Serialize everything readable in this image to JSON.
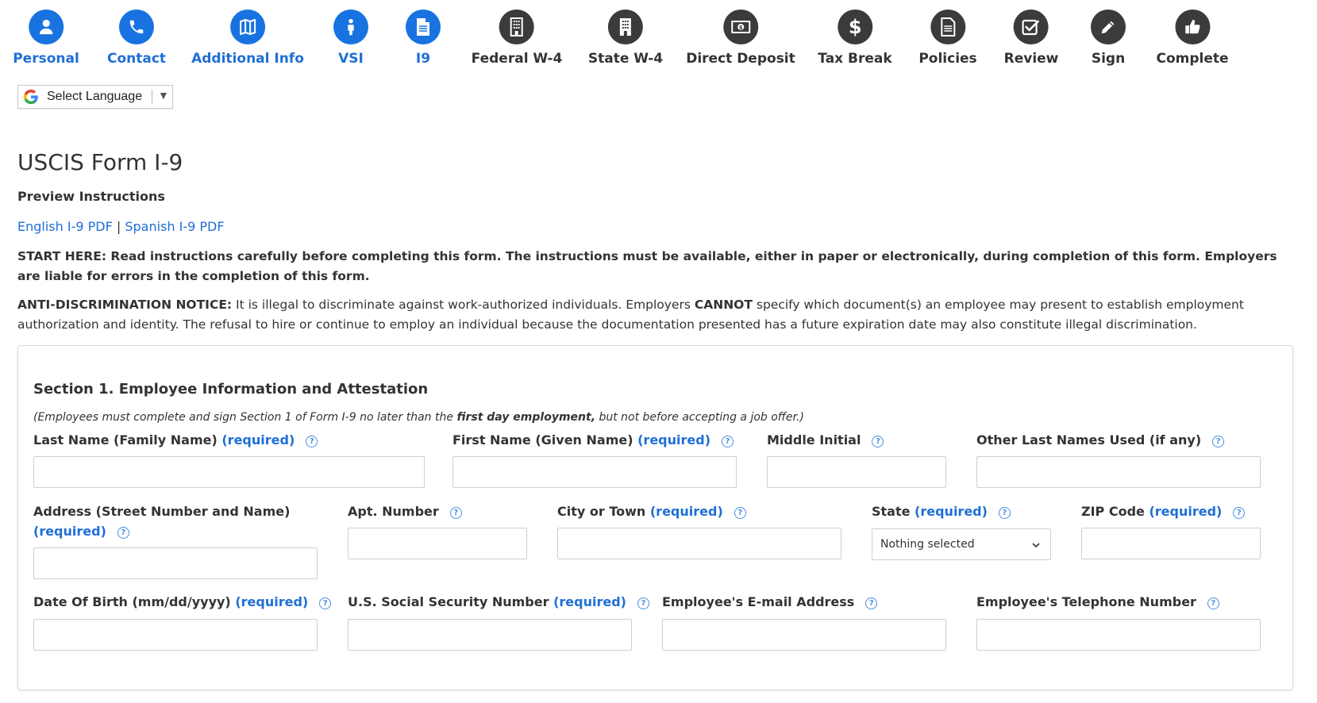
{
  "steps": [
    {
      "label": "Personal",
      "icon": "person-icon",
      "state": "active"
    },
    {
      "label": "Contact",
      "icon": "phone-icon",
      "state": "active"
    },
    {
      "label": "Additional Info",
      "icon": "map-icon",
      "state": "active"
    },
    {
      "label": "VSI",
      "icon": "figure-icon",
      "state": "active"
    },
    {
      "label": "I9",
      "icon": "document-icon",
      "state": "active"
    },
    {
      "label": "Federal W-4",
      "icon": "building-icon",
      "state": "pending"
    },
    {
      "label": "State W-4",
      "icon": "office-building-icon",
      "state": "pending"
    },
    {
      "label": "Direct Deposit",
      "icon": "money-icon",
      "state": "pending"
    },
    {
      "label": "Tax Break",
      "icon": "dollar-icon",
      "state": "pending"
    },
    {
      "label": "Policies",
      "icon": "policy-document-icon",
      "state": "pending"
    },
    {
      "label": "Review",
      "icon": "checkbox-icon",
      "state": "pending"
    },
    {
      "label": "Sign",
      "icon": "pencil-icon",
      "state": "pending"
    },
    {
      "label": "Complete",
      "icon": "thumbs-up-icon",
      "state": "pending"
    }
  ],
  "colors": {
    "active": "#1873e0",
    "pending": "#3b3b3b",
    "link": "#1f6fd6"
  },
  "language": {
    "label": "Select Language",
    "arrow": "▼"
  },
  "page": {
    "title": "USCIS Form I-9",
    "preview": "Preview Instructions",
    "english_pdf": "English I-9 PDF",
    "separator": " | ",
    "spanish_pdf": "Spanish I-9 PDF",
    "start_here": "START HERE: Read instructions carefully before completing this form. The instructions must be available, either in paper or electronically, during completion of this form. Employers are liable for errors in the completion of this form.",
    "anti_label": "ANTI-DISCRIMINATION NOTICE:",
    "anti_text1": " It is illegal to discriminate against work-authorized individuals. Employers ",
    "anti_cannot": "CANNOT",
    "anti_text2": " specify which document(s) an employee may present to establish employment authorization and identity. The refusal to hire or continue to employ an individual because the documentation presented has a future expiration date may also constitute illegal discrimination."
  },
  "section": {
    "title": "Section 1. Employee Information and Attestation",
    "note_pre": "(Employees must complete and sign Section 1 of Form I-9 no later than the ",
    "note_bold": "first day employment,",
    "note_post": " but not before accepting a job offer.)",
    "required": "(required)",
    "help": "?",
    "fields": {
      "last_name": "Last Name (Family Name)",
      "first_name": "First Name (Given Name)",
      "middle_initial": "Middle Initial",
      "other_last_names": "Other Last Names Used (if any)",
      "address": "Address (Street Number and Name)",
      "apt": "Apt. Number",
      "city": "City or Town",
      "state": "State",
      "state_value": "Nothing selected",
      "zip": "ZIP Code",
      "dob": "Date Of Birth (mm/dd/yyyy)",
      "ssn": "U.S. Social Security Number",
      "email": "Employee's E-mail Address",
      "phone": "Employee's Telephone Number"
    }
  }
}
